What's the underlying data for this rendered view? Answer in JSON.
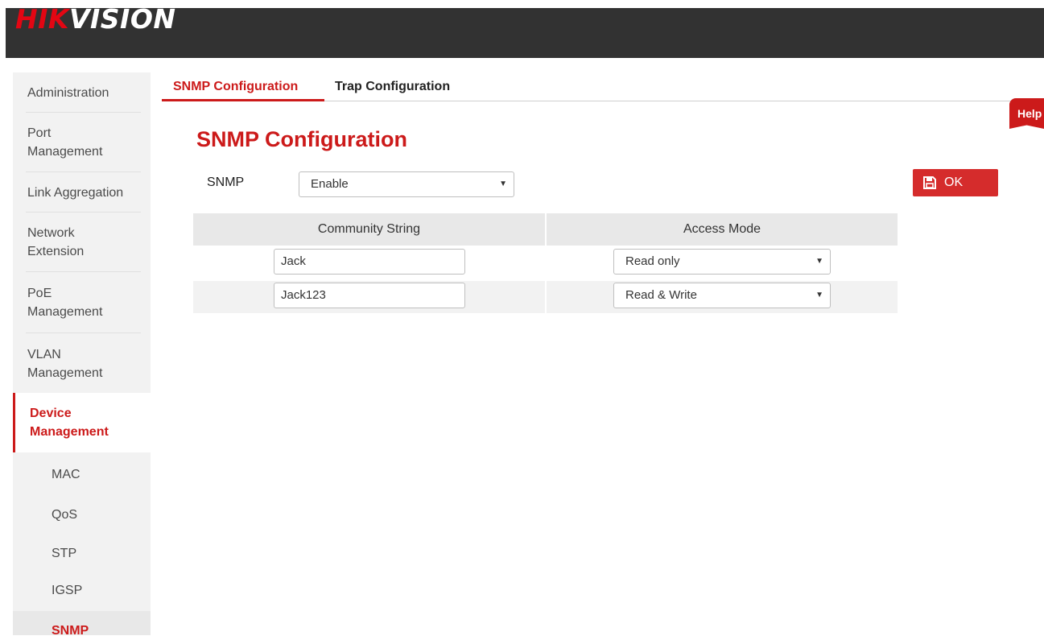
{
  "brand": {
    "logo_part1": "HIK",
    "logo_part2": "VISION"
  },
  "sidebar": {
    "items": [
      {
        "label": "Administration"
      },
      {
        "label_line1": "Port",
        "label_line2": "Management"
      },
      {
        "label": "Link Aggregation"
      },
      {
        "label_line1": "Network",
        "label_line2": "Extension"
      },
      {
        "label_line1": "PoE",
        "label_line2": "Management"
      },
      {
        "label_line1": "VLAN",
        "label_line2": "Management"
      },
      {
        "label_line1": "Device",
        "label_line2": "Management"
      }
    ],
    "sub_items": [
      {
        "label": "MAC"
      },
      {
        "label": "QoS"
      },
      {
        "label": "STP"
      },
      {
        "label": "IGSP"
      },
      {
        "label": "SNMP"
      }
    ]
  },
  "tabs": [
    {
      "label": "SNMP Configuration"
    },
    {
      "label": "Trap Configuration"
    }
  ],
  "help": {
    "label": "Help"
  },
  "main": {
    "title": "SNMP Configuration",
    "snmp_label": "SNMP",
    "snmp_value": "Enable",
    "ok_label": "OK",
    "table": {
      "headers": [
        "Community String",
        "Access Mode"
      ],
      "rows": [
        {
          "community": "Jack",
          "access": "Read only"
        },
        {
          "community": "Jack123",
          "access": "Read & Write"
        }
      ]
    }
  },
  "colors": {
    "accent": "#cc1a1a",
    "topbar": "#323232",
    "sidebar_bg": "#f2f2f2"
  }
}
